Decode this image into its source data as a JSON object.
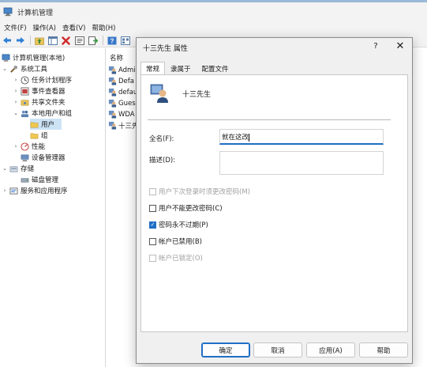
{
  "window": {
    "title": "计算机管理"
  },
  "menu": [
    "文件(F)",
    "操作(A)",
    "查看(V)",
    "帮助(H)"
  ],
  "toolbar": {
    "icons": [
      "back-arrow-icon",
      "forward-arrow-icon",
      "folder-up-icon",
      "show-hide-tree-icon",
      "delete-icon",
      "properties-icon",
      "export-icon",
      "help-icon",
      "view-icon"
    ]
  },
  "tree": {
    "root": "计算机管理(本地)",
    "system_tools": "系统工具",
    "task_scheduler": "任务计划程序",
    "event_viewer": "事件查看器",
    "shared_folders": "共享文件夹",
    "local_users_groups": "本地用户和组",
    "users": "用户",
    "groups": "组",
    "performance": "性能",
    "device_manager": "设备管理器",
    "storage": "存储",
    "disk_management": "磁盘管理",
    "services_apps": "服务和应用程序"
  },
  "list": {
    "header": "名称",
    "rows": [
      "Admi",
      "Defa",
      "defau",
      "Gues",
      "WDA",
      "十三先"
    ]
  },
  "dialog": {
    "title": "十三先生 属性",
    "help_symbol": "?",
    "close_symbol": "✕",
    "tabs": [
      "常规",
      "隶属于",
      "配置文件"
    ],
    "user_name": "十三先生",
    "fullname_label": "全名(F):",
    "fullname_value": "就在这改",
    "description_label": "描述(D):",
    "description_value": "",
    "checkboxes": [
      {
        "label": "用户下次登录时须更改密码(M)",
        "checked": false,
        "enabled": false
      },
      {
        "label": "用户不能更改密码(C)",
        "checked": false,
        "enabled": true
      },
      {
        "label": "密码永不过期(P)",
        "checked": true,
        "enabled": true
      },
      {
        "label": "帐户已禁用(B)",
        "checked": false,
        "enabled": true
      },
      {
        "label": "帐户已锁定(O)",
        "checked": false,
        "enabled": false
      }
    ],
    "buttons": {
      "ok": "确定",
      "cancel": "取消",
      "apply": "应用(A)",
      "help": "帮助"
    }
  },
  "colors": {
    "accent": "#1f6fc5",
    "selection": "#cce3f6"
  }
}
